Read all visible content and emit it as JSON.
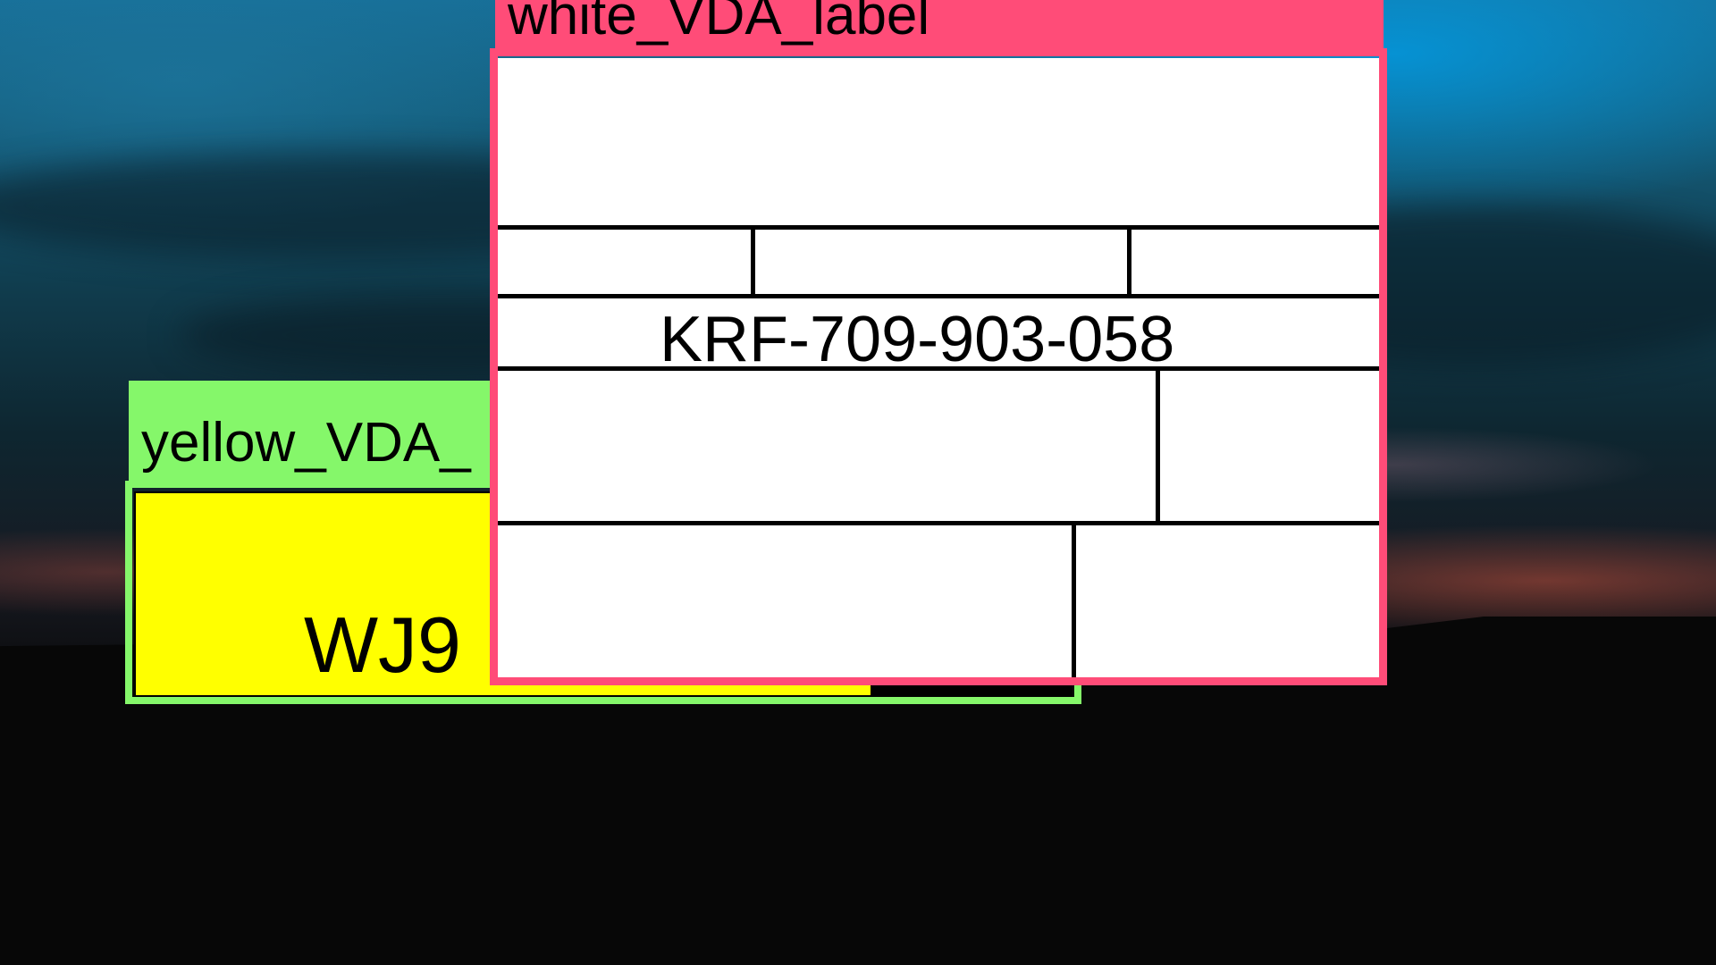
{
  "scene": {
    "background": "sunset-sky-landscape-photo"
  },
  "yellow_label": {
    "tag_text": "yellow_VDA_",
    "code": "WJ9",
    "tag_color": "#85f76a",
    "panel_color": "#ffff00"
  },
  "white_label": {
    "tag_text": "white_VDA_label",
    "code": "KRF-709-903-058",
    "tag_color": "#ff4c78",
    "panel_color": "#ffffff"
  }
}
